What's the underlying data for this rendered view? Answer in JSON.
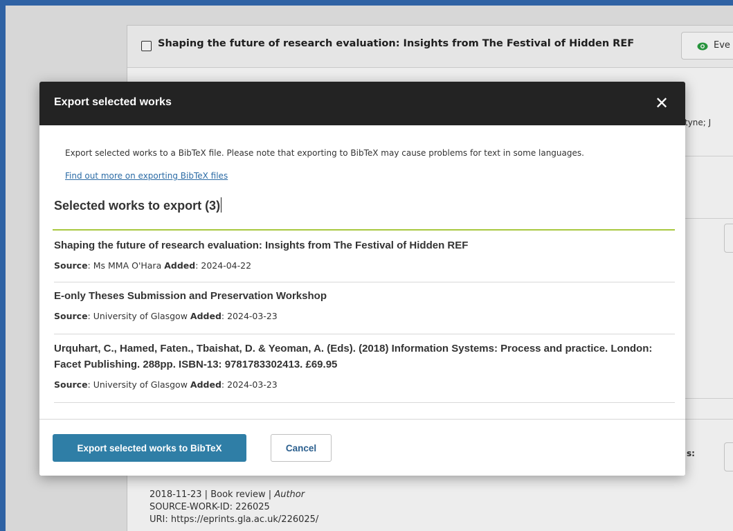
{
  "background": {
    "card_title": "Shaping the future of research evaluation: Insights from The Festival of Hidden REF",
    "view_button_label": "Eve",
    "author_snippet": "tyne; J",
    "label_snippet": "s:",
    "bottom_line1_prefix": "2018-11-23 | Book review | ",
    "bottom_line1_role": "Author",
    "bottom_line2": "SOURCE-WORK-ID: 226025",
    "bottom_line3": "URI: https://eprints.gla.ac.uk/226025/"
  },
  "modal": {
    "title": "Export selected works",
    "intro": "Export selected works to a BibTeX file. Please note that exporting to BibTeX may cause problems for text in some languages.",
    "link": "Find out more on exporting BibTeX files",
    "section_title": "Selected works to export (3)",
    "source_label": "Source",
    "added_label": "Added",
    "works": [
      {
        "title": "Shaping the future of research evaluation: Insights from The Festival of Hidden REF",
        "source": "Ms MMA O'Hara",
        "added": "2024-04-22"
      },
      {
        "title": "E-only Theses Submission and Preservation Workshop",
        "source": "University of Glasgow",
        "added": "2024-03-23"
      },
      {
        "title": "Urquhart, C., Hamed, Faten., Tbaishat, D. & Yeoman, A. (Eds). (2018) Information Systems: Process and practice. London: Facet Publishing. 288pp. ISBN-13: 9781783302413. £69.95",
        "source": "University of Glasgow",
        "added": "2024-03-23"
      }
    ],
    "export_button": "Export selected works to BibTeX",
    "cancel_button": "Cancel",
    "close_glyph": "✕"
  },
  "colors": {
    "frame_blue": "#2f62a4",
    "header_dark": "#232323",
    "accent_green": "#a8c83e",
    "primary_button": "#2f7ea6",
    "eye_icon": "#2aa042"
  }
}
